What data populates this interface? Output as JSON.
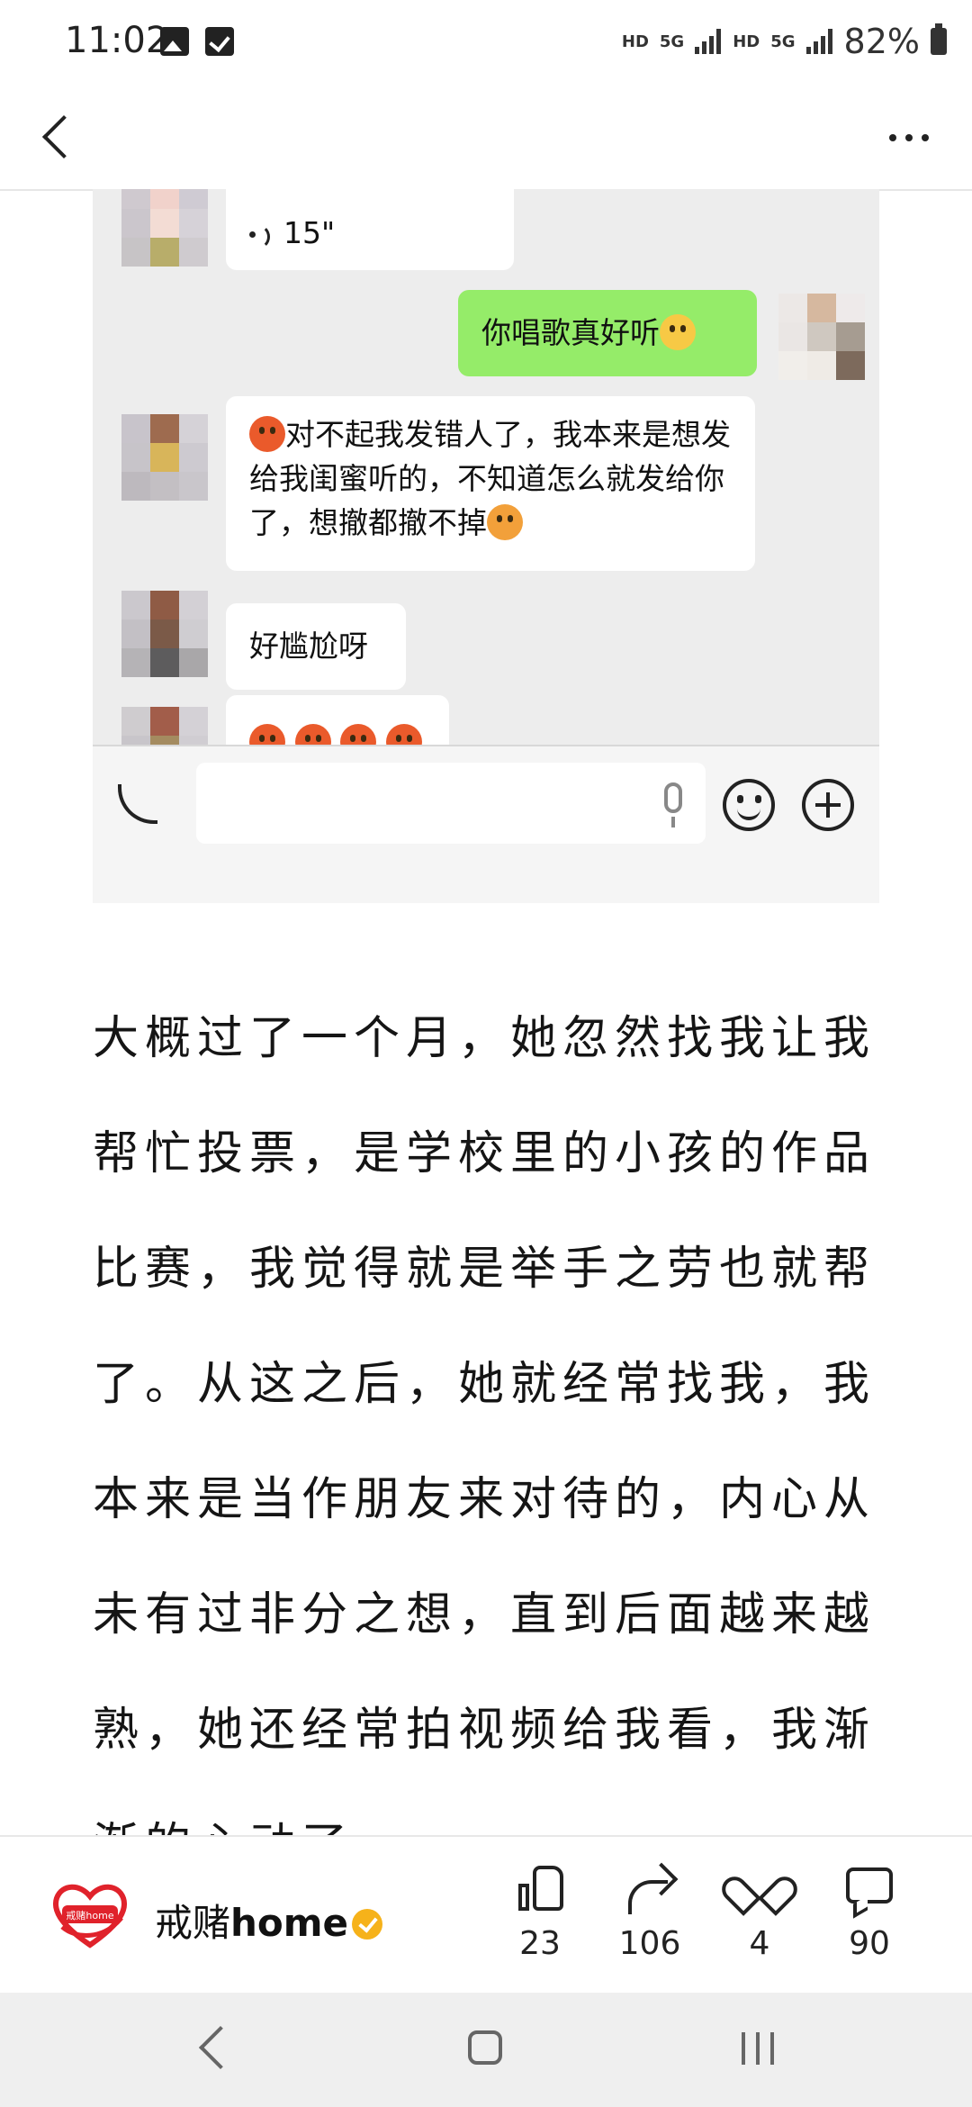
{
  "status_bar": {
    "time": "11:02",
    "network_1": "HD",
    "network_2": "5G",
    "network_3": "HD",
    "network_4": "5G",
    "battery": "82%",
    "icons": [
      "image-icon",
      "checkbox-icon",
      "signal-icon",
      "battery-icon"
    ]
  },
  "nav": {
    "back_icon": "chevron-left-icon",
    "more_icon": "more-dots-icon"
  },
  "chat": {
    "voice_message": "15\"",
    "sent_message": "你唱歌真好听",
    "message_1": "对不起我发错人了，我本来是想发给我闺蜜听的，不知道怎么就发给你了，想撤都撤不掉",
    "message_2": "好尴尬呀",
    "input_placeholder": "",
    "icons": [
      "voice-toggle-icon",
      "mic-icon",
      "emoji-icon",
      "plus-icon"
    ]
  },
  "article": {
    "paragraph": "大概过了一个月，她忽然找我让我帮忙投票，是学校里的小孩的作品比赛，我觉得就是举手之劳也就帮了。从这之后，她就经常找我，我本来是当作朋友来对待的，内心从未有过非分之想，直到后面越来越熟，她还经常拍视频给我看，我渐渐的心动了。"
  },
  "author": {
    "logo_text": "戒赌home",
    "name_prefix": "戒赌",
    "name_suffix": "home",
    "verified_icon": "verified-badge-icon"
  },
  "actions": {
    "like_count": "23",
    "share_count": "106",
    "favorite_count": "4",
    "comment_count": "90"
  },
  "colors": {
    "chat_bg": "#ededed",
    "sent_bubble": "#95ec69",
    "badge": "#f6b21a",
    "logo_red": "#e0222b"
  }
}
